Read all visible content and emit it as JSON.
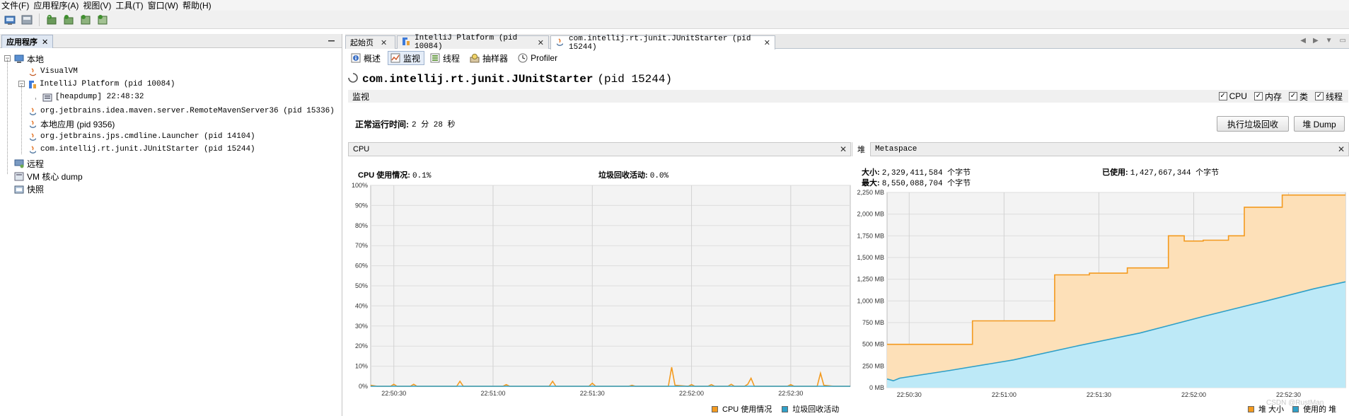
{
  "menu": [
    "文件(F)",
    "应用程序(A)",
    "视图(V)",
    "工具(T)",
    "窗口(W)",
    "帮助(H)"
  ],
  "left_panel": {
    "tab_label": "应用程序",
    "tab_close": "✕",
    "minimize": "—",
    "tree": [
      {
        "label": "本地",
        "mono": false,
        "depth": 0,
        "expander": "−",
        "icon": "computer-icon"
      },
      {
        "label": "VisualVM",
        "mono": true,
        "depth": 1,
        "expander": "",
        "icon": "visualvm-icon"
      },
      {
        "label": "IntelliJ Platform (pid 10084)",
        "mono": true,
        "depth": 1,
        "expander": "−",
        "icon": "intellij-icon"
      },
      {
        "label": "[heapdump] 22:48:32",
        "mono": true,
        "depth": 2,
        "expander": "",
        "icon": "heapdump-icon"
      },
      {
        "label": "org.jetbrains.idea.maven.server.RemoteMavenServer36 (pid 15336)",
        "mono": true,
        "depth": 1,
        "expander": "",
        "icon": "java-icon"
      },
      {
        "label": "本地应用 (pid 9356)",
        "mono": false,
        "depth": 1,
        "expander": "",
        "icon": "java-icon"
      },
      {
        "label": "org.jetbrains.jps.cmdline.Launcher (pid 14104)",
        "mono": true,
        "depth": 1,
        "expander": "",
        "icon": "java-icon"
      },
      {
        "label": "com.intellij.rt.junit.JUnitStarter (pid 15244)",
        "mono": true,
        "depth": 1,
        "expander": "",
        "icon": "java-icon"
      },
      {
        "label": "远程",
        "mono": false,
        "depth": 0,
        "expander": "",
        "icon": "remote-icon"
      },
      {
        "label": "VM 核心 dump",
        "mono": false,
        "depth": 0,
        "expander": "",
        "icon": "coredump-icon"
      },
      {
        "label": "快照",
        "mono": false,
        "depth": 0,
        "expander": "",
        "icon": "snapshot-icon"
      }
    ]
  },
  "doc_tabs": [
    {
      "label": "起始页",
      "active": false
    },
    {
      "label": "IntelliJ Platform (pid 10084)",
      "active": false
    },
    {
      "label": "com.intellij.rt.junit.JUnitStarter (pid 15244)",
      "active": true
    }
  ],
  "view_tabs": [
    "概述",
    "监视",
    "线程",
    "抽样器",
    "Profiler"
  ],
  "process": {
    "name": "com.intellij.rt.junit.JUnitStarter",
    "pid": "(pid 15244)"
  },
  "monitor": {
    "label": "监视",
    "checks": [
      {
        "label": "CPU",
        "checked": true
      },
      {
        "label": "内存",
        "checked": true
      },
      {
        "label": "类",
        "checked": true
      },
      {
        "label": "线程",
        "checked": true
      }
    ],
    "uptime_label": "正常运行时间:",
    "uptime_value": "2 分 28 秒",
    "gc_button": "执行垃圾回收",
    "heap_dump_button": "堆 Dump"
  },
  "cpu_panel": {
    "title": "CPU",
    "close": "✕",
    "cpu_usage_label": "CPU 使用情况:",
    "cpu_usage_value": "0.1%",
    "gc_label": "垃圾回收活动:",
    "gc_value": "0.0%",
    "legend_cpu": "CPU 使用情况",
    "legend_gc": "垃圾回收活动"
  },
  "heap_panel": {
    "tab_heap": "堆",
    "tab_metaspace": "Metaspace",
    "close": "✕",
    "size_label": "大小:",
    "size_value": "2,329,411,584 个字节",
    "max_label": "最大:",
    "max_value": "8,550,088,704 个字节",
    "used_label": "已使用:",
    "used_value": "1,427,667,344 个字节",
    "legend_size": "堆 大小",
    "legend_used": "使用的 堆",
    "watermark": "CSDN @RustMan"
  },
  "colors": {
    "cpu_line": "#f39a1f",
    "gc_line": "#2fa0c8",
    "heap_size_fill": "#fde0b8",
    "heap_size_line": "#f39a1f",
    "heap_used_fill": "#bde9f7",
    "heap_used_line": "#2fa0c8"
  },
  "chart_data": [
    {
      "type": "line",
      "title": "CPU",
      "ylim": [
        0,
        100
      ],
      "y_ticks": [
        "0%",
        "10%",
        "20%",
        "30%",
        "40%",
        "50%",
        "60%",
        "70%",
        "80%",
        "90%",
        "100%"
      ],
      "x_ticks": [
        "22:50:30",
        "22:51:00",
        "22:51:30",
        "22:52:00",
        "22:52:30"
      ],
      "grid": true,
      "legend": "bottom-right",
      "x_range_seconds": [
        0,
        145
      ],
      "series": [
        {
          "name": "CPU 使用情况",
          "points": [
            [
              0,
              0.5
            ],
            [
              2,
              0
            ],
            [
              6,
              0
            ],
            [
              7,
              1
            ],
            [
              8,
              0
            ],
            [
              12,
              0
            ],
            [
              13,
              1
            ],
            [
              14,
              0
            ],
            [
              26,
              0
            ],
            [
              27,
              2.5
            ],
            [
              28,
              0
            ],
            [
              40,
              0
            ],
            [
              41,
              0.8
            ],
            [
              42,
              0
            ],
            [
              54,
              0
            ],
            [
              55,
              2.5
            ],
            [
              56,
              0
            ],
            [
              66,
              0
            ],
            [
              67,
              1.5
            ],
            [
              68,
              0
            ],
            [
              78,
              0
            ],
            [
              79,
              0.5
            ],
            [
              80,
              0
            ],
            [
              90,
              0
            ],
            [
              91,
              9.5
            ],
            [
              92,
              0.5
            ],
            [
              96,
              0
            ],
            [
              97,
              0.8
            ],
            [
              98,
              0
            ],
            [
              102,
              0
            ],
            [
              103,
              0.8
            ],
            [
              104,
              0
            ],
            [
              108,
              0
            ],
            [
              109,
              1
            ],
            [
              110,
              0
            ],
            [
              113,
              0
            ],
            [
              114,
              1
            ],
            [
              115,
              4
            ],
            [
              116,
              0
            ],
            [
              126,
              0
            ],
            [
              127,
              0.8
            ],
            [
              128,
              0
            ],
            [
              135,
              0
            ],
            [
              136,
              6.5
            ],
            [
              137,
              0.5
            ],
            [
              140,
              0
            ],
            [
              145,
              0
            ]
          ]
        },
        {
          "name": "垃圾回收活动",
          "points": [
            [
              0,
              0
            ],
            [
              145,
              0
            ]
          ]
        }
      ]
    },
    {
      "type": "area",
      "title": "堆",
      "ylim": [
        0,
        2250
      ],
      "y_ticks": [
        "0 MB",
        "250 MB",
        "500 MB",
        "750 MB",
        "1,000 MB",
        "1,250 MB",
        "1,500 MB",
        "1,750 MB",
        "2,000 MB",
        "2,250 MB"
      ],
      "x_ticks": [
        "22:50:30",
        "22:51:00",
        "22:51:30",
        "22:52:00",
        "22:52:30"
      ],
      "grid": true,
      "legend": "bottom-right",
      "x_range_seconds": [
        0,
        145
      ],
      "series": [
        {
          "name": "堆 大小",
          "points": [
            [
              0,
              500
            ],
            [
              27,
              500
            ],
            [
              27,
              770
            ],
            [
              53,
              770
            ],
            [
              53,
              1300
            ],
            [
              64,
              1300
            ],
            [
              64,
              1320
            ],
            [
              76,
              1320
            ],
            [
              76,
              1380
            ],
            [
              89,
              1380
            ],
            [
              89,
              1750
            ],
            [
              94,
              1750
            ],
            [
              94,
              1690
            ],
            [
              100,
              1690
            ],
            [
              100,
              1700
            ],
            [
              108,
              1700
            ],
            [
              108,
              1750
            ],
            [
              113,
              1750
            ],
            [
              113,
              2080
            ],
            [
              125,
              2080
            ],
            [
              125,
              2220
            ],
            [
              140,
              2220
            ],
            [
              145,
              2220
            ]
          ]
        },
        {
          "name": "使用的 堆",
          "points": [
            [
              0,
              100
            ],
            [
              2,
              80
            ],
            [
              4,
              110
            ],
            [
              20,
              200
            ],
            [
              40,
              320
            ],
            [
              60,
              480
            ],
            [
              80,
              630
            ],
            [
              100,
              820
            ],
            [
              120,
              1000
            ],
            [
              135,
              1140
            ],
            [
              145,
              1220
            ]
          ]
        }
      ]
    }
  ]
}
